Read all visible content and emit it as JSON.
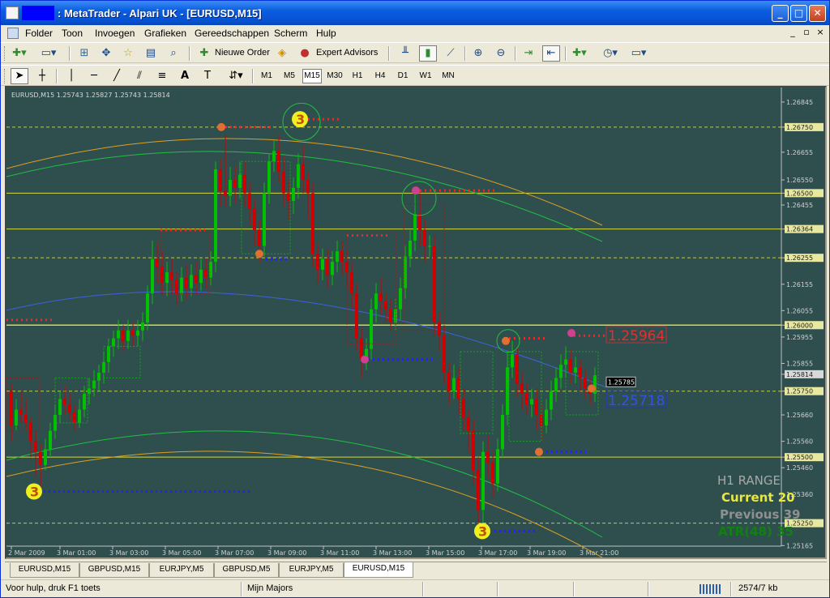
{
  "window": {
    "title": ": MetaTrader - Alpari UK - [EURUSD,M15]",
    "buttons": {
      "minimize": "_",
      "maximize": "□",
      "close": "✕"
    }
  },
  "menu": {
    "items": [
      "Folder",
      "Toon",
      "Invoegen",
      "Grafieken",
      "Gereedschappen",
      "Scherm",
      "Hulp"
    ],
    "mdi_controls": {
      "minimize": "_",
      "restore": "▫",
      "close": "×"
    }
  },
  "toolbar1": {
    "new_order": "Nieuwe Order",
    "expert_advisors": "Expert Advisors",
    "icons": [
      "new-chart-icon",
      "profiles-icon",
      "market-watch-icon",
      "navigator-icon",
      "favorites-icon",
      "terminal-icon",
      "tester-icon",
      "new-order-icon",
      "meta-editor-icon",
      "expert-advisors-icon",
      "bar-chart-icon",
      "candlestick-icon",
      "line-chart-icon",
      "zoom-in-icon",
      "zoom-out-icon",
      "autoscroll-icon",
      "chart-shift-icon",
      "indicators-icon",
      "periods-icon",
      "templates-icon"
    ]
  },
  "toolbar2": {
    "timeframes": [
      "M1",
      "M5",
      "M15",
      "M30",
      "H1",
      "H4",
      "D1",
      "W1",
      "MN"
    ],
    "active_timeframe": "M15"
  },
  "chart_data": {
    "type": "candlestick",
    "symbol_header": "EURUSD,M15  1.25743  1.25827  1.25743  1.25814",
    "y_ticks": [
      "1.26845",
      "1.26750",
      "1.26655",
      "1.26550",
      "1.26500",
      "1.26455",
      "1.26364",
      "1.26255",
      "1.26155",
      "1.26055",
      "1.26000",
      "1.25955",
      "1.25855",
      "1.25814",
      "1.25750",
      "1.25660",
      "1.25560",
      "1.25500",
      "1.25460",
      "1.25360",
      "1.25250",
      "1.25165"
    ],
    "ylim": [
      1.2512,
      1.269
    ],
    "x_ticks": [
      "2 Mar 2009",
      "3 Mar 01:00",
      "3 Mar 03:00",
      "3 Mar 05:00",
      "3 Mar 07:00",
      "3 Mar 09:00",
      "3 Mar 11:00",
      "3 Mar 13:00",
      "3 Mar 15:00",
      "3 Mar 17:00",
      "3 Mar 19:00",
      "3 Mar 21:00"
    ],
    "highlighted_levels": [
      "1.26750",
      "1.26500",
      "1.26364",
      "1.26255",
      "1.26000",
      "1.25814",
      "1.25750",
      "1.25500",
      "1.25250"
    ],
    "current_price": "1.25814",
    "price_box": "1.25785",
    "level_labels": {
      "resistance": "1.25964",
      "support": "1.25718"
    },
    "info_panel": {
      "range_title": "H1 RANGE",
      "current": "Current 20",
      "previous": "Previous 39",
      "atr": "ATR(48) 35"
    },
    "colors": {
      "background": "#2f4f4f",
      "bull": "#00c000",
      "bear": "#d00000",
      "grid": "#7a8a8a",
      "yellow_line": "#e8e840",
      "green_curve": "#20c040",
      "orange_curve": "#e0a020",
      "blue_curve": "#4060e0"
    },
    "marker_label": "3"
  },
  "tabs": {
    "items": [
      "EURUSD,M15",
      "GBPUSD,M15",
      "EURJPY,M5",
      "GBPUSD,M5",
      "EURJPY,M5",
      "EURUSD,M15"
    ],
    "active_index": 5
  },
  "status": {
    "help": "Voor hulp, druk F1 toets",
    "profile": "Mijn Majors",
    "traffic": "2574/7 kb"
  }
}
